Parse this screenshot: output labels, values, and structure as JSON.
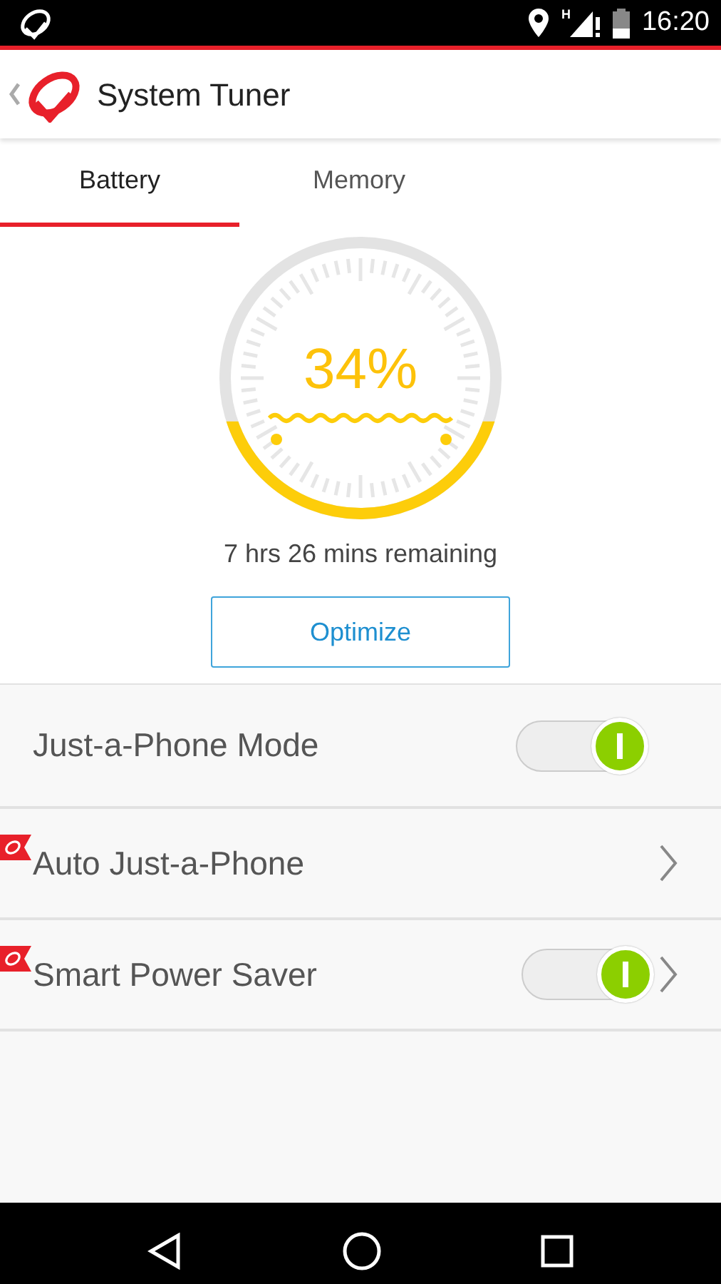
{
  "status_bar": {
    "time": "16:20",
    "network": "H"
  },
  "app_bar": {
    "title": "System Tuner"
  },
  "tabs": [
    {
      "label": "Battery",
      "selected": true
    },
    {
      "label": "Memory",
      "selected": false
    }
  ],
  "battery": {
    "percent": "34%",
    "remaining": "7 hrs 26 mins remaining"
  },
  "optimize_button": "Optimize",
  "settings": [
    {
      "kind": "toggle",
      "label": "Just-a-Phone Mode",
      "badge": false,
      "on": true,
      "chevron": false
    },
    {
      "kind": "link",
      "label": "Auto Just-a-Phone",
      "badge": true,
      "chevron": true
    },
    {
      "kind": "toggle",
      "label": "Smart Power Saver",
      "badge": true,
      "on": true,
      "chevron": true
    }
  ]
}
